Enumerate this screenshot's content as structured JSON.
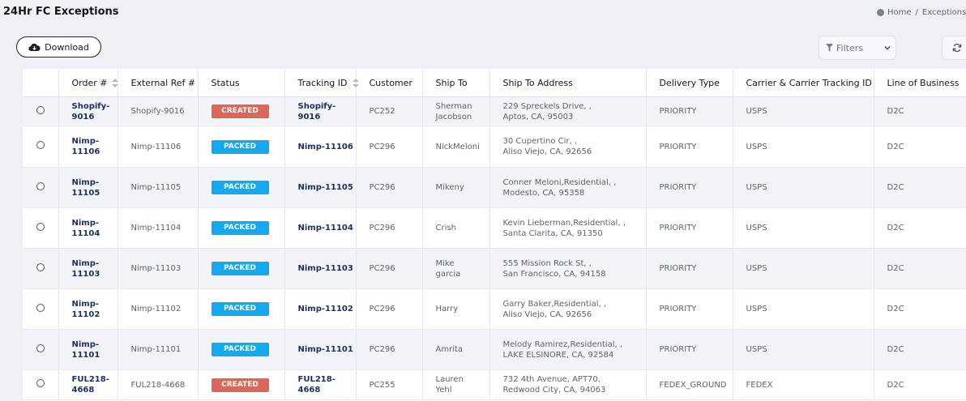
{
  "page": {
    "title": "24Hr FC Exceptions",
    "breadcrumb": {
      "home": "Home",
      "sep": "/",
      "current": "Exceptions",
      "trail": "/"
    }
  },
  "toolbar": {
    "download_label": "Download",
    "filters_label": "Filters"
  },
  "table": {
    "columns": {
      "order": "Order #",
      "external_ref": "External Ref #",
      "status": "Status",
      "tracking_id": "Tracking ID",
      "customer": "Customer",
      "ship_to": "Ship To",
      "ship_to_address": "Ship To Address",
      "delivery_type": "Delivery Type",
      "carrier": "Carrier & Carrier Tracking ID",
      "line_of_business": "Line of Business"
    },
    "rows": [
      {
        "order": [
          "Shopify-",
          "9016"
        ],
        "external_ref": "Shopify-9016",
        "status": "CREATED",
        "status_color": "#d9675a",
        "tracking": [
          "Shopify-",
          "9016"
        ],
        "customer": "PC252",
        "ship_to": [
          "Sherman",
          "Jacobson"
        ],
        "address": [
          "229 Spreckels Drive, ,",
          "Aptos, CA, 95003"
        ],
        "delivery": "PRIORITY",
        "carrier": "USPS",
        "lob": "D2C"
      },
      {
        "order": [
          "Nimp-",
          "11106"
        ],
        "external_ref": "Nimp-11106",
        "status": "PACKED",
        "status_color": "#14a8ee",
        "tracking": [
          "Nimp-11106"
        ],
        "customer": "PC296",
        "ship_to": [
          "NickMeloni"
        ],
        "address": [
          "30 Cupertino Cir, ,",
          "Aliso Viejo, CA, 92656"
        ],
        "delivery": "PRIORITY",
        "carrier": "USPS",
        "lob": "D2C"
      },
      {
        "order": [
          "Nimp-",
          "11105"
        ],
        "external_ref": "Nimp-11105",
        "status": "PACKED",
        "status_color": "#14a8ee",
        "tracking": [
          "Nimp-11105"
        ],
        "customer": "PC296",
        "ship_to": [
          "Mikeny"
        ],
        "address": [
          "Conner Meloni,Residential, ,",
          "Modesto, CA, 95358"
        ],
        "delivery": "PRIORITY",
        "carrier": "USPS",
        "lob": "D2C"
      },
      {
        "order": [
          "Nimp-",
          "11104"
        ],
        "external_ref": "Nimp-11104",
        "status": "PACKED",
        "status_color": "#14a8ee",
        "tracking": [
          "Nimp-11104"
        ],
        "customer": "PC296",
        "ship_to": [
          "Crish"
        ],
        "address": [
          "Kevin Lieberman,Residential, ,",
          "Santa Clarita, CA, 91350"
        ],
        "delivery": "PRIORITY",
        "carrier": "USPS",
        "lob": "D2C"
      },
      {
        "order": [
          "Nimp-",
          "11103"
        ],
        "external_ref": "Nimp-11103",
        "status": "PACKED",
        "status_color": "#14a8ee",
        "tracking": [
          "Nimp-11103"
        ],
        "customer": "PC296",
        "ship_to": [
          "Mike",
          "garcia"
        ],
        "address": [
          "555 Mission Rock St, ,",
          "San Francisco, CA, 94158"
        ],
        "delivery": "PRIORITY",
        "carrier": "USPS",
        "lob": "D2C"
      },
      {
        "order": [
          "Nimp-",
          "11102"
        ],
        "external_ref": "Nimp-11102",
        "status": "PACKED",
        "status_color": "#14a8ee",
        "tracking": [
          "Nimp-11102"
        ],
        "customer": "PC296",
        "ship_to": [
          "Harry"
        ],
        "address": [
          "Garry Baker,Residential, ,",
          "Aliso Viejo, CA, 92656"
        ],
        "delivery": "PRIORITY",
        "carrier": "USPS",
        "lob": "D2C"
      },
      {
        "order": [
          "Nimp-",
          "11101"
        ],
        "external_ref": "Nimp-11101",
        "status": "PACKED",
        "status_color": "#14a8ee",
        "tracking": [
          "Nimp-11101"
        ],
        "customer": "PC296",
        "ship_to": [
          "Amrita"
        ],
        "address": [
          "Melody Ramirez,Residential, ,",
          "LAKE ELSINORE, CA, 92584"
        ],
        "delivery": "PRIORITY",
        "carrier": "USPS",
        "lob": "D2C"
      },
      {
        "order": [
          "FUL218-",
          "4668"
        ],
        "external_ref": "FUL218-4668",
        "status": "CREATED",
        "status_color": "#d9675a",
        "tracking": [
          "FUL218-",
          "4668"
        ],
        "customer": "PC255",
        "ship_to": [
          "Lauren",
          "Yehl"
        ],
        "address": [
          "732 4th Avenue, APT70,",
          "Redwood City, CA, 94063"
        ],
        "delivery": "FEDEX_GROUND",
        "carrier": "FEDEX",
        "lob": "D2C"
      }
    ]
  }
}
